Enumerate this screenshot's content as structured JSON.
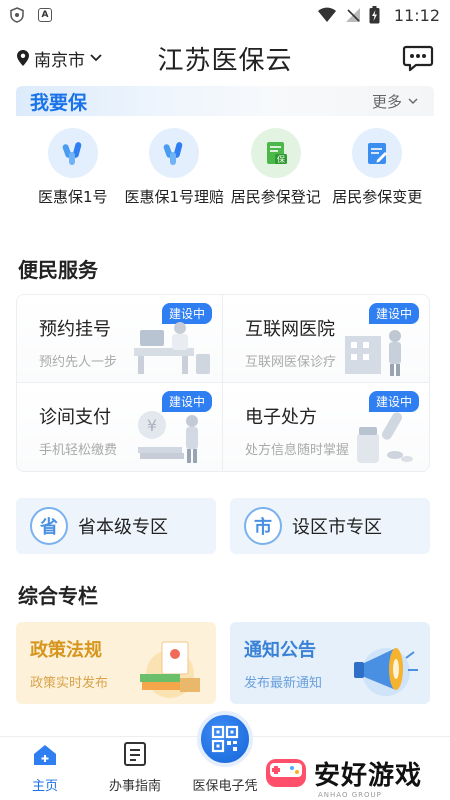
{
  "status_bar": {
    "time": "11:12",
    "left_icons": [
      "shield-icon",
      "a-icon"
    ],
    "right_icons": [
      "wifi-icon",
      "no-signal-icon",
      "battery-icon"
    ]
  },
  "header": {
    "city": "南京市",
    "title": "江苏医保云",
    "message_icon": "chat-icon"
  },
  "insure": {
    "title": "我要保",
    "more_label": "更多",
    "items": [
      {
        "label": "医惠保1号",
        "icon": "health-leaf-icon"
      },
      {
        "label": "医惠保1号理赔",
        "icon": "health-leaf-icon"
      },
      {
        "label": "居民参保登记",
        "icon": "register-document-icon"
      },
      {
        "label": "居民参保变更",
        "icon": "edit-document-icon"
      }
    ],
    "item_icon_text": "保"
  },
  "services": {
    "title": "便民服务",
    "badge_label": "建设中",
    "items": [
      {
        "name": "预约挂号",
        "sub": "预约先人一步"
      },
      {
        "name": "互联网医院",
        "sub": "互联网医保诊疗"
      },
      {
        "name": "诊间支付",
        "sub": "手机轻松缴费"
      },
      {
        "name": "电子处方",
        "sub": "处方信息随时掌握"
      }
    ]
  },
  "zones": [
    {
      "icon_text": "省",
      "label": "省本级专区"
    },
    {
      "icon_text": "市",
      "label": "设区市专区"
    }
  ],
  "columns": {
    "title": "综合专栏",
    "items": [
      {
        "title": "政策法规",
        "sub": "政策实时发布",
        "bg": "#fdf1da",
        "title_color": "#d6951c",
        "sub_color": "#d9a44a"
      },
      {
        "title": "通知公告",
        "sub": "发布最新通知",
        "bg": "#e6f0fb",
        "title_color": "#3a82d6",
        "sub_color": "#6aa0dc"
      }
    ]
  },
  "bottom_nav": {
    "items": [
      {
        "label": "主页",
        "icon": "home-icon"
      },
      {
        "label": "办事指南",
        "icon": "guide-icon"
      },
      {
        "label": "医保电子凭",
        "icon": "qr-code-icon"
      }
    ]
  },
  "watermark": {
    "text": "安好游戏",
    "sub": "ANHAO GROUP"
  },
  "colors": {
    "accent": "#1a73e8",
    "badge": "#2f7ef2"
  }
}
